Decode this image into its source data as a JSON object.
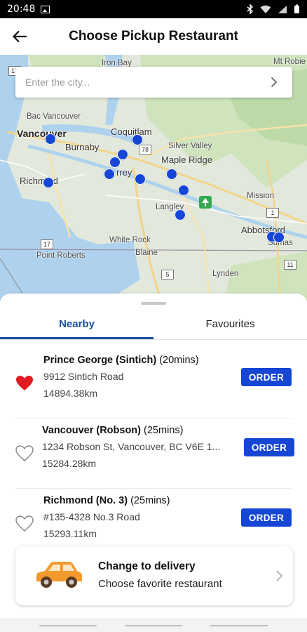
{
  "status_bar": {
    "time": "20:48"
  },
  "header": {
    "title": "Choose Pickup Restaurant"
  },
  "search": {
    "placeholder": "Enter the city..."
  },
  "map": {
    "labels": {
      "iron_bay": "Iron Bay",
      "mt_robie": "Mt Robie",
      "bac_vancouver": "Bac Vancouver",
      "vancouver": "Vancouver",
      "burnaby": "Burnaby",
      "coquitlam": "Coquitlam",
      "silver_valley": "Silver Valley",
      "maple_ridge": "Maple Ridge",
      "surrey": "rrey",
      "richmond": "Richm   nd",
      "langley": "Langley",
      "mission": "Mission",
      "abbotsford": "Abbotsford",
      "white_rock": "White Rock",
      "blaine": "Blaine",
      "point_roberts": "Point Roberts",
      "lynden": "Lynden",
      "sumas": "Sumas"
    },
    "route_numbers": [
      "78",
      "17",
      "17",
      "1",
      "5",
      "11"
    ]
  },
  "tabs": [
    {
      "label": "Nearby",
      "active": true
    },
    {
      "label": "Favourites",
      "active": false
    }
  ],
  "restaurants": [
    {
      "name": "Prince George (Sintich)",
      "time": "(20mins)",
      "address": "9912 Sintich Road",
      "distance": "14894.38km",
      "favourite": true,
      "order_label": "ORDER"
    },
    {
      "name": "Vancouver (Robson)",
      "time": "(25mins)",
      "address": "1234 Robson St, Vancouver, BC V6E 1...",
      "distance": "15284.28km",
      "favourite": false,
      "order_label": "ORDER"
    },
    {
      "name": "Richmond (No. 3)",
      "time": "(25mins)",
      "address": "#135-4328 No.3 Road",
      "distance": "15293.11km",
      "favourite": false,
      "order_label": "ORDER"
    }
  ],
  "delivery": {
    "title": "Change to delivery",
    "subtitle": "Choose favorite restaurant"
  },
  "colors": {
    "primary": "#1546d4",
    "tab_active": "#1a4fa0",
    "heart": "#e11b22",
    "pin": "#1646d8",
    "car": "#f29a2e"
  }
}
